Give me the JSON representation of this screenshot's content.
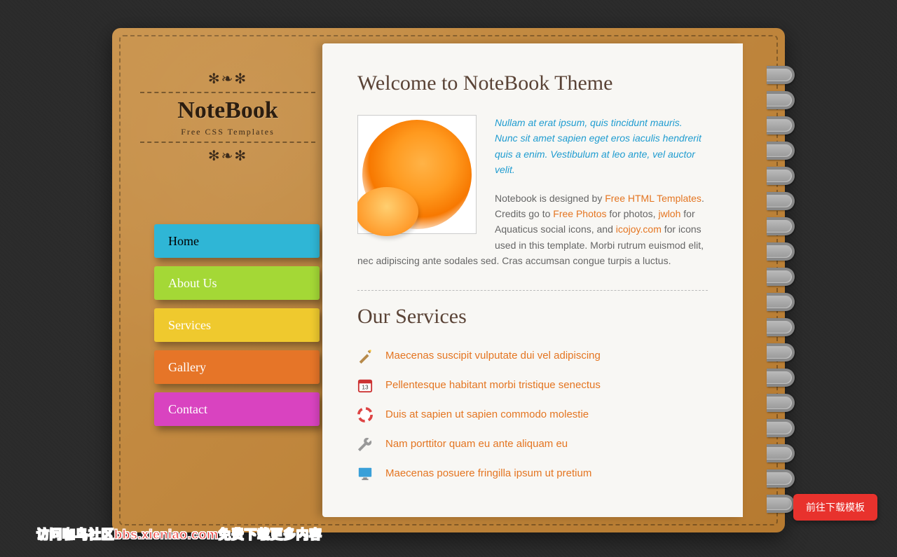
{
  "logo": {
    "title": "NoteBook",
    "subtitle": "Free CSS Templates"
  },
  "nav": {
    "items": [
      {
        "label": "Home"
      },
      {
        "label": "About Us"
      },
      {
        "label": "Services"
      },
      {
        "label": "Gallery"
      },
      {
        "label": "Contact"
      }
    ]
  },
  "content": {
    "heading": "Welcome to NoteBook Theme",
    "lead": "Nullam at erat ipsum, quis tincidunt mauris. Nunc sit amet sapien eget eros iaculis hendrerit quis a enim. Vestibulum at leo ante, vel auctor velit.",
    "body_parts": {
      "p1": "Notebook is designed by ",
      "link1": "Free HTML Templates",
      "p2": ". Credits go to ",
      "link2": "Free Photos",
      "p3": " for photos, ",
      "link3": "jwloh",
      "p4": " for Aquaticus social icons, and ",
      "link4": "icojoy.com",
      "p5": " for icons used in this template. Morbi rutrum euismod elit, nec adipiscing ante sodales sed. Cras accumsan congue turpis a luctus."
    },
    "services_heading": "Our Services",
    "services": [
      {
        "text": "Maecenas suscipit vulputate dui vel adipiscing",
        "icon": "wand"
      },
      {
        "text": "Pellentesque habitant morbi tristique senectus",
        "icon": "calendar"
      },
      {
        "text": "Duis at sapien ut sapien commodo molestie",
        "icon": "lifebuoy"
      },
      {
        "text": "Nam porttitor quam eu ante aliquam eu",
        "icon": "wrench"
      },
      {
        "text": "Maecenas posuere fringilla ipsum ut pretium",
        "icon": "monitor"
      }
    ]
  },
  "download_button": "前往下载模板",
  "footer_text": "访问咖鸟社区bbs.xieniao.com免费下载更多内容"
}
